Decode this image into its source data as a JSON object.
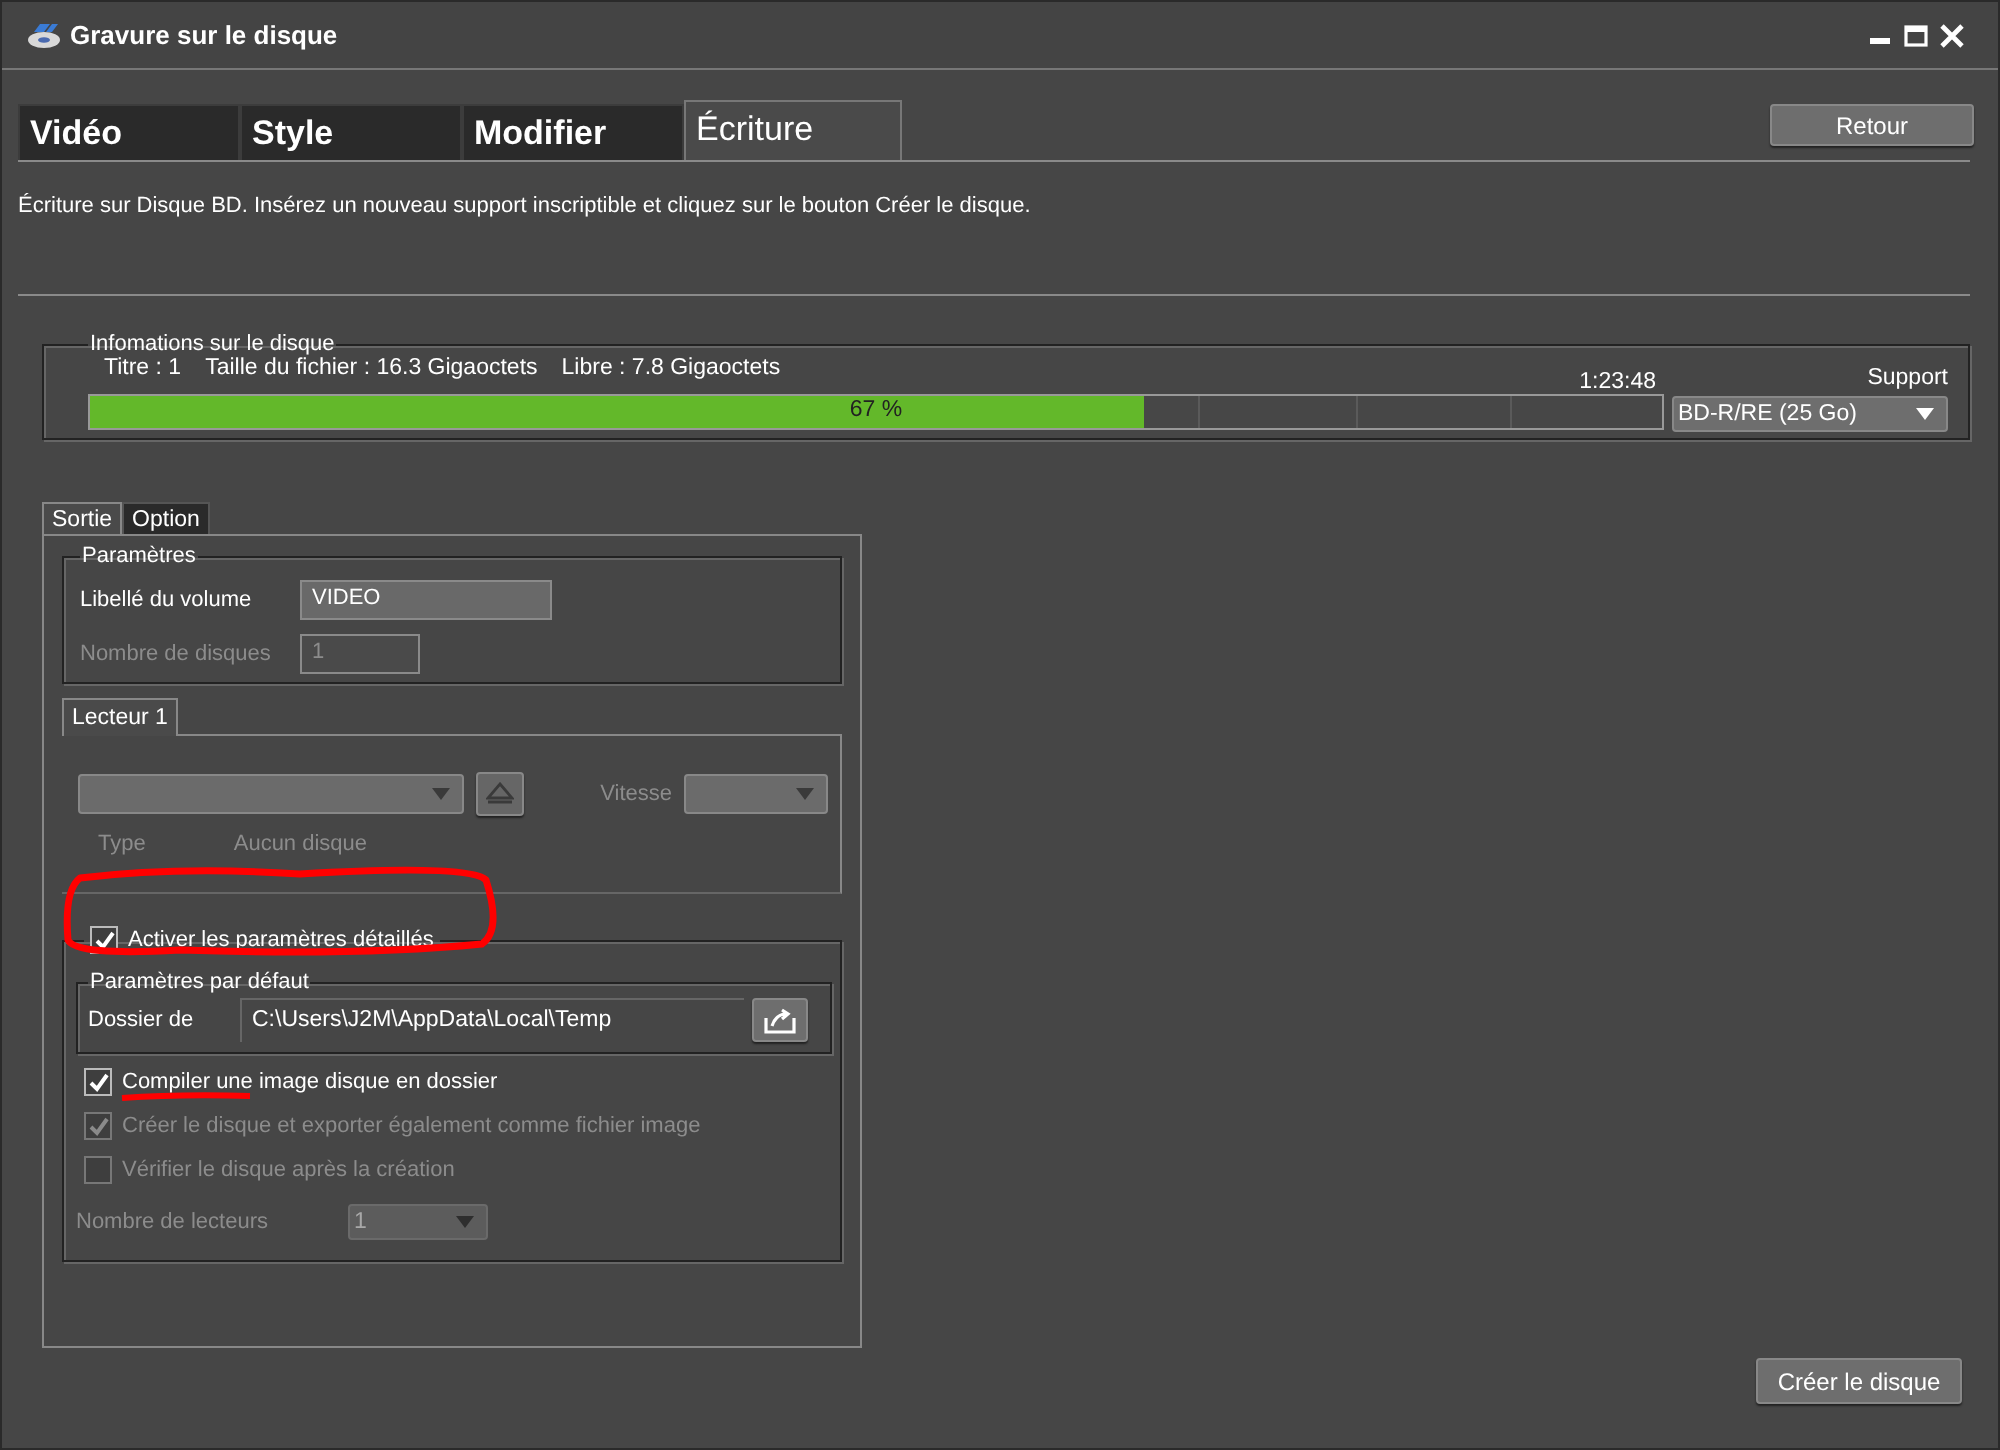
{
  "window": {
    "title": "Gravure sur le disque"
  },
  "tabs": [
    {
      "label": "Vidéo",
      "selected": false
    },
    {
      "label": "Style",
      "selected": false
    },
    {
      "label": "Modifier",
      "selected": false
    },
    {
      "label": "Écriture",
      "selected": true
    }
  ],
  "back_button": "Retour",
  "description": "Écriture sur Disque BD. Insérez un nouveau support inscriptible et cliquez sur le bouton Créer le disque.",
  "disc_info": {
    "title": "Infomations sur le disque",
    "summary": [
      "Titre : 1",
      "Taille du fichier : 16.3 Gigaoctets",
      "Libre : 7.8 Gigaoctets"
    ],
    "duration": "1:23:48",
    "usage": {
      "level": 0.67,
      "reading": "67 %"
    },
    "support": {
      "label": "Support",
      "value": "BD-R/RE (25 Go)"
    }
  },
  "output_tabs": [
    {
      "label": "Sortie",
      "selected": true
    },
    {
      "label": "Option",
      "selected": false
    }
  ],
  "parameters": {
    "title": "Paramètres",
    "fields": [
      {
        "label": "Libellé du volume",
        "value": "VIDEO",
        "disabled": false
      },
      {
        "label": "Nombre de disques",
        "value": "1",
        "disabled": true
      }
    ]
  },
  "drive": {
    "tab": "Lecteur 1",
    "speed_label": "Vitesse",
    "type_label": "Type",
    "type_value": "Aucun disque"
  },
  "advanced": {
    "label": "Activer les paramètres détaillés",
    "checked": true,
    "defaults": {
      "title": "Paramètres par défaut",
      "folder_label": "Dossier de",
      "folder_value": "C:\\Users\\J2M\\AppData\\Local\\Temp"
    },
    "options": [
      {
        "label": "Compiler une image disque en dossier",
        "checked": true,
        "disabled": false
      },
      {
        "label": "Créer le disque et exporter également comme fichier image",
        "checked": true,
        "disabled": true
      },
      {
        "label": "Vérifier le disque après la création",
        "checked": false,
        "disabled": true
      }
    ],
    "drive_count": {
      "label": "Nombre de lecteurs",
      "value": "1",
      "disabled": true
    }
  },
  "create_button": "Créer le disque"
}
